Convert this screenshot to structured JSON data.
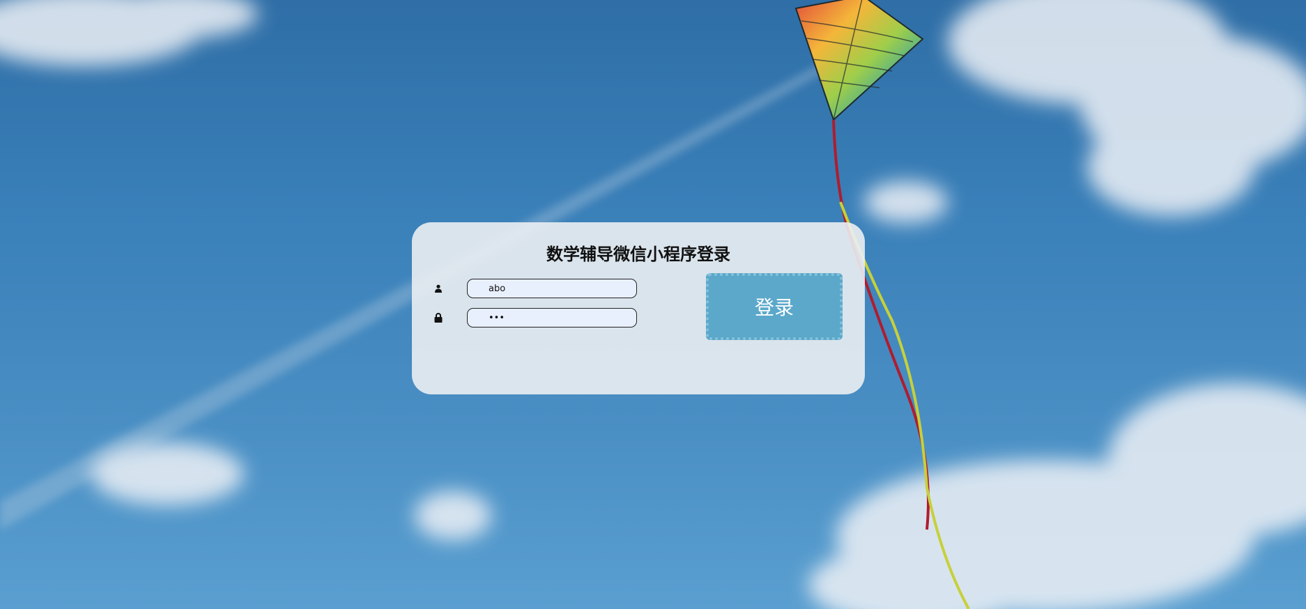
{
  "login": {
    "title": "数学辅导微信小程序登录",
    "username_value": "abo",
    "password_value": "abc",
    "button_label": "登录"
  },
  "icons": {
    "username": "user-icon",
    "password": "lock-icon"
  },
  "colors": {
    "sky": "#3a80b9",
    "card": "#ebeef2",
    "input_bg": "#e8f0fe",
    "button": "#5ba8ca",
    "button_border": "#86c2db"
  }
}
